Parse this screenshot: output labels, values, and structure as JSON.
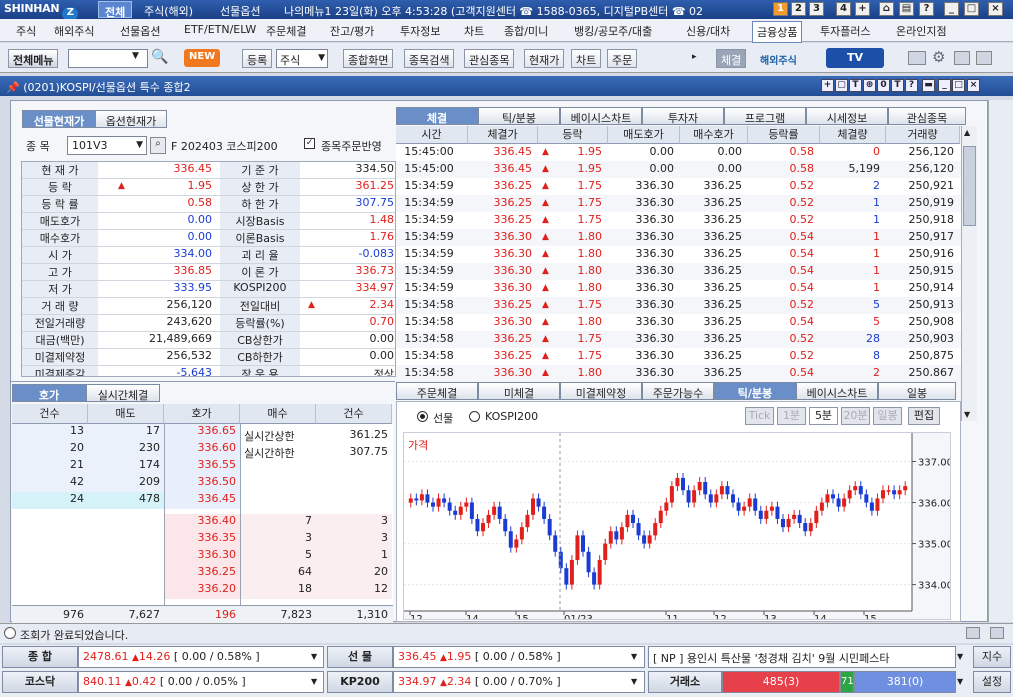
{
  "titlebar": {
    "brand": "SHINHAN",
    "tabs": [
      "전체",
      "주식(해외)",
      "선물옵션"
    ],
    "info": "나의메뉴1 23일(화) 오후 4:53:28 (고객지원센터 ☎ 1588-0365, 디지털PB센터 ☎ 02",
    "nums": [
      "1",
      "2",
      "3",
      "4"
    ]
  },
  "menu": [
    "주식",
    "해외주식",
    "선물옵션",
    "ETF/ETN/ELW",
    "주문체결",
    "잔고/평가",
    "투자정보",
    "차트",
    "종합/미니",
    "뱅킹/공모주/대출",
    "신용/대차",
    "금융상품",
    "투자플러스",
    "온라인지점"
  ],
  "toolbar": {
    "menu_btn": "전체메뉴",
    "new_badge": "NEW",
    "buttons": [
      "등록",
      "주식",
      "종합화면",
      "종목검색",
      "관심종목",
      "현재가",
      "차트",
      "주문"
    ],
    "right_btn": "체결",
    "overseas": "해외주식",
    "tv": "TV"
  },
  "window": {
    "title": "(0201)KOSPI/선물옵션 특수 종합2"
  },
  "left": {
    "tabs": [
      "선물현재가",
      "옵션현재가"
    ],
    "code_label": "종  목",
    "code": "101V3",
    "code_name": "F 202403 코스피200",
    "checkbox": "종목주문반영",
    "rows": [
      [
        "현 재 가",
        "336.45",
        "",
        "기 준 가",
        "334.50"
      ],
      [
        "등    락",
        "1.95",
        "up",
        "상 한 가",
        "361.25"
      ],
      [
        "등 락 률",
        "0.58",
        "",
        "하 한 가",
        "307.75"
      ],
      [
        "매도호가",
        "0.00",
        "",
        "시장Basis",
        "1.48"
      ],
      [
        "매수호가",
        "0.00",
        "",
        "이론Basis",
        "1.76"
      ],
      [
        "시    가",
        "334.00",
        "",
        "괴 리 율",
        "-0.083"
      ],
      [
        "고    가",
        "336.85",
        "",
        "이 론 가",
        "336.73"
      ],
      [
        "저    가",
        "333.95",
        "",
        "KOSPI200",
        "334.97"
      ],
      [
        "거 래 량",
        "256,120",
        "",
        "전일대비",
        "2.34"
      ],
      [
        "전일거래량",
        "243,620",
        "",
        "등락률(%)",
        "0.70"
      ],
      [
        "대금(백만)",
        "21,489,669",
        "",
        "CB상한가",
        "0.00"
      ],
      [
        "미결제약정",
        "256,532",
        "",
        "CB하한가",
        "0.00"
      ],
      [
        "미결제증감",
        "-5,643",
        "",
        "장 운 용",
        "정상"
      ]
    ]
  },
  "orderbook": {
    "tabs": [
      "호가",
      "실시간체결"
    ],
    "headers": [
      "건수",
      "매도",
      "호가",
      "매수",
      "건수"
    ],
    "asks": [
      [
        "13",
        "17",
        "336.65"
      ],
      [
        "20",
        "230",
        "336.60"
      ],
      [
        "21",
        "174",
        "336.55"
      ],
      [
        "42",
        "209",
        "336.50"
      ],
      [
        "24",
        "478",
        "336.45"
      ]
    ],
    "bids": [
      [
        "336.40",
        "7",
        "3"
      ],
      [
        "336.35",
        "3",
        "3"
      ],
      [
        "336.30",
        "5",
        "1"
      ],
      [
        "336.25",
        "64",
        "20"
      ],
      [
        "336.20",
        "18",
        "12"
      ]
    ],
    "limit_up_label": "실시간상한",
    "limit_up": "361.25",
    "limit_dn_label": "실시간하한",
    "limit_dn": "307.75",
    "totals": [
      "976",
      "7,627",
      "196",
      "7,823",
      "1,310"
    ]
  },
  "trades": {
    "tabs": [
      "체결",
      "틱/분봉",
      "베이시스차트",
      "투자자",
      "프로그램",
      "시세정보",
      "관심종목"
    ],
    "headers": [
      "시간",
      "체결가",
      "등락",
      "매도호가",
      "매수호가",
      "등락률",
      "체결량",
      "거래량"
    ],
    "rows": [
      [
        "15:45:00",
        "336.45",
        "1.95",
        "0.00",
        "0.00",
        "0.58",
        "0",
        "256,120",
        "n"
      ],
      [
        "15:45:00",
        "336.45",
        "1.95",
        "0.00",
        "0.00",
        "0.58",
        "5,199",
        "256,120",
        "n"
      ],
      [
        "15:34:59",
        "336.25",
        "1.75",
        "336.30",
        "336.25",
        "0.52",
        "2",
        "250,921",
        "b"
      ],
      [
        "15:34:59",
        "336.25",
        "1.75",
        "336.30",
        "336.25",
        "0.52",
        "1",
        "250,919",
        "b"
      ],
      [
        "15:34:59",
        "336.25",
        "1.75",
        "336.30",
        "336.25",
        "0.52",
        "1",
        "250,918",
        "b"
      ],
      [
        "15:34:59",
        "336.30",
        "1.80",
        "336.30",
        "336.25",
        "0.54",
        "1",
        "250,917",
        "r"
      ],
      [
        "15:34:59",
        "336.30",
        "1.80",
        "336.30",
        "336.25",
        "0.54",
        "1",
        "250,916",
        "r"
      ],
      [
        "15:34:59",
        "336.30",
        "1.80",
        "336.30",
        "336.25",
        "0.54",
        "1",
        "250,915",
        "r"
      ],
      [
        "15:34:59",
        "336.30",
        "1.80",
        "336.30",
        "336.25",
        "0.54",
        "1",
        "250,914",
        "r"
      ],
      [
        "15:34:58",
        "336.25",
        "1.75",
        "336.30",
        "336.25",
        "0.52",
        "5",
        "250,913",
        "b"
      ],
      [
        "15:34:58",
        "336.30",
        "1.80",
        "336.30",
        "336.25",
        "0.54",
        "5",
        "250,908",
        "r"
      ],
      [
        "15:34:58",
        "336.25",
        "1.75",
        "336.30",
        "336.25",
        "0.52",
        "28",
        "250,903",
        "b"
      ],
      [
        "15:34:58",
        "336.25",
        "1.75",
        "336.30",
        "336.25",
        "0.52",
        "8",
        "250,875",
        "b"
      ],
      [
        "15:34:58",
        "336.30",
        "1.80",
        "336.30",
        "336.25",
        "0.54",
        "2",
        "250,867",
        "r"
      ]
    ]
  },
  "chartpane": {
    "tabs": [
      "주문체결",
      "미체결",
      "미결제약정",
      "주문가능수량",
      "틱/분봉",
      "베이시스차트",
      "일봉"
    ],
    "radio1": "선물",
    "radio2": "KOSPI200",
    "periods": [
      "Tick",
      "1분",
      "5분",
      "20분",
      "일봉"
    ],
    "edit": "편집",
    "label": "가격"
  },
  "chart_data": {
    "type": "candlestick",
    "title": "가격",
    "yticks": [
      "337.00",
      "336.00",
      "335.00",
      "334.00"
    ],
    "ylim": [
      333.6,
      337.5
    ],
    "xticks": [
      "12",
      "14",
      "15",
      "01/23",
      "11",
      "12",
      "13",
      "14",
      "15"
    ],
    "close": [
      336.1,
      336.05,
      336.2,
      336.0,
      335.9,
      336.1,
      336.0,
      335.8,
      335.7,
      335.9,
      336.0,
      335.6,
      335.3,
      335.5,
      335.7,
      335.9,
      335.6,
      335.3,
      334.9,
      335.1,
      335.4,
      335.7,
      336.1,
      335.9,
      335.6,
      335.2,
      334.8,
      334.4,
      334.0,
      334.6,
      335.2,
      334.8,
      334.3,
      334.0,
      334.6,
      335.0,
      335.3,
      335.1,
      335.4,
      335.7,
      335.5,
      335.2,
      335.0,
      335.2,
      335.5,
      335.8,
      336.0,
      336.4,
      336.6,
      336.3,
      336.0,
      336.3,
      336.5,
      336.2,
      336.0,
      336.2,
      336.4,
      336.2,
      336.0,
      335.8,
      335.9,
      336.1,
      335.8,
      335.6,
      335.8,
      335.9,
      335.6,
      335.4,
      335.6,
      335.7,
      335.5,
      335.3,
      335.5,
      335.8,
      336.0,
      336.2,
      336.1,
      335.9,
      336.1,
      336.3,
      336.4,
      336.2,
      336.0,
      335.8,
      336.1,
      336.3,
      336.3,
      336.2,
      336.3,
      336.4
    ]
  },
  "status": "조회가 완료되었습니다.",
  "tickerbar": {
    "r1": [
      {
        "lab": "종  합",
        "val": "2478.61",
        "chg": "14.26",
        "br": "[ 0.00  /  0.58%  ]"
      },
      {
        "lab": "선  물",
        "val": "336.45",
        "chg": "1.95",
        "br": "[ 0.00  /  0.58%  ]"
      }
    ],
    "news": "[ NP ] 용인시 특산물 '청경채 김치' 9월 시민페스타",
    "news_btn": "지수",
    "r2": [
      {
        "lab": "코스닥",
        "val": "840.11",
        "chg": "0.42",
        "br": "[ 0.00  /  0.05%  ]"
      },
      {
        "lab": "KP200",
        "val": "334.97",
        "chg": "2.34",
        "br": "[ 0.00  /  0.70%  ]"
      }
    ],
    "vol_label": "거래소",
    "up": "485(3)",
    "flat": "71",
    "down": "381(0)",
    "setting": "설정"
  }
}
